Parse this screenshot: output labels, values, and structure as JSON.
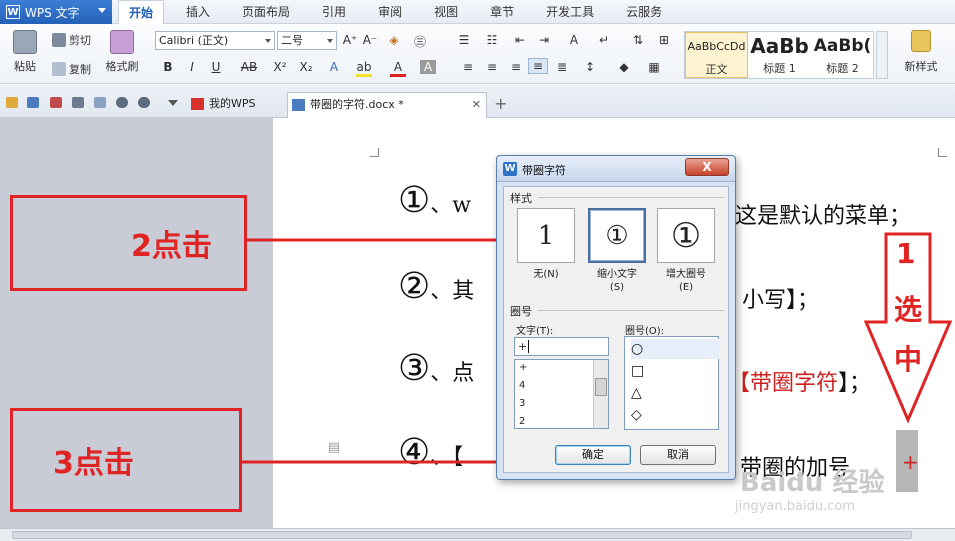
{
  "app": {
    "name": "WPS 文字"
  },
  "menu_tabs": [
    "开始",
    "插入",
    "页面布局",
    "引用",
    "审阅",
    "视图",
    "章节",
    "开发工具",
    "云服务"
  ],
  "ribbon": {
    "paste": "粘贴",
    "cut": "剪切",
    "copy": "复制",
    "format_painter": "格式刷",
    "font_name": "Calibri (正文)",
    "font_size": "二号",
    "styles": [
      {
        "sample": "AaBbCcDd",
        "name": "正文"
      },
      {
        "sample": "AaBb",
        "name": "标题 1"
      },
      {
        "sample": "AaBb(",
        "name": "标题 2"
      }
    ],
    "new_style": "新样式"
  },
  "doc_tabs": [
    {
      "label": "我的WPS"
    },
    {
      "label": "带圈的字符.docx *"
    }
  ],
  "document": {
    "lines": [
      {
        "num": "①",
        "before": "、w",
        "after": "这是默认的菜单；",
        "red": ""
      },
      {
        "num": "②",
        "before": "、其",
        "after": "小写】；",
        "red": ""
      },
      {
        "num": "③",
        "before": "、点",
        "after": "】；",
        "red": "【带圈字符"
      },
      {
        "num": "④",
        "before": "、【",
        "after": "带圈的加号",
        "red": ""
      }
    ],
    "selected_char": "+"
  },
  "annotations": {
    "step1": "1\n选\n中",
    "step1_parts": [
      "1",
      "选",
      "中"
    ],
    "step2": "2点击",
    "step3": "3点击"
  },
  "dialog": {
    "title": "带圈字符",
    "close": "X",
    "style_group": "样式",
    "style_options": [
      {
        "glyph": "1",
        "label": "无(N)"
      },
      {
        "glyph": "①",
        "label": "缩小文字\n(S)"
      },
      {
        "glyph": "①",
        "label": "增大圈号\n(E)"
      }
    ],
    "style_labels": {
      "none": "无(N)",
      "shrink_1": "缩小文字",
      "shrink_2": "(S)",
      "enlarge_1": "增大圈号",
      "enlarge_2": "(E)"
    },
    "circle_group": "圈号",
    "text_label": "文字(T):",
    "text_value": "+",
    "text_items": [
      "+",
      "4",
      "3",
      "2"
    ],
    "shape_label": "圈号(O):",
    "shape_items": [
      "○",
      "□",
      "△",
      "◇"
    ],
    "ok": "确定",
    "cancel": "取消"
  },
  "watermark": {
    "main": "Baidu 经验",
    "sub": "jingyan.baidu.com"
  },
  "colors": {
    "annotation_red": "#e02424",
    "accent_blue": "#2461b7"
  }
}
